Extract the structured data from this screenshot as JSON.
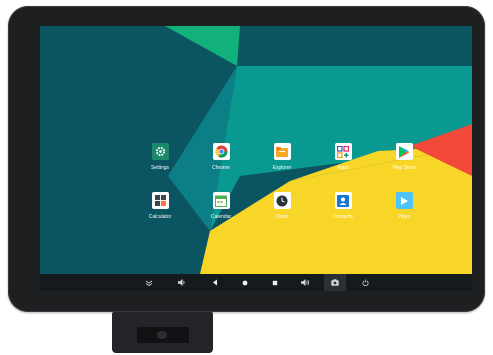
{
  "apps": [
    {
      "label": "Settings",
      "icon": "settings-icon",
      "bg": "#1b8a6b"
    },
    {
      "label": "Chrome",
      "icon": "chrome-icon",
      "bg": "#ffffff"
    },
    {
      "label": "Explorer",
      "icon": "explorer-icon",
      "bg": "#ffffff"
    },
    {
      "label": "Apps",
      "icon": "apps-grid-icon",
      "bg": "#ffffff"
    },
    {
      "label": "Play Store",
      "icon": "play-store-icon",
      "bg": "#ffffff"
    },
    {
      "label": "Calculator",
      "icon": "calculator-icon",
      "bg": "#ffffff"
    },
    {
      "label": "Calendar",
      "icon": "calendar-icon",
      "bg": "#ffffff"
    },
    {
      "label": "Clock",
      "icon": "clock-icon",
      "bg": "#ffffff"
    },
    {
      "label": "Contacts",
      "icon": "contacts-icon",
      "bg": "#ffffff"
    },
    {
      "label": "Video",
      "icon": "video-icon",
      "bg": "#4fc3f7"
    }
  ],
  "navbar": {
    "buttons": [
      "collapse-icon",
      "volume-down-icon",
      "back-icon",
      "home-icon",
      "recents-icon",
      "volume-up-icon",
      "screenshot-icon",
      "power-icon"
    ]
  },
  "colors": {
    "wallpaper_teal_dark": "#0b5563",
    "wallpaper_teal": "#00a495",
    "wallpaper_green": "#12b07a",
    "wallpaper_yellow": "#f7d627",
    "wallpaper_red": "#f2493a",
    "navbar_bg": "#151a1d",
    "device_bezel": "#1e1f21"
  }
}
